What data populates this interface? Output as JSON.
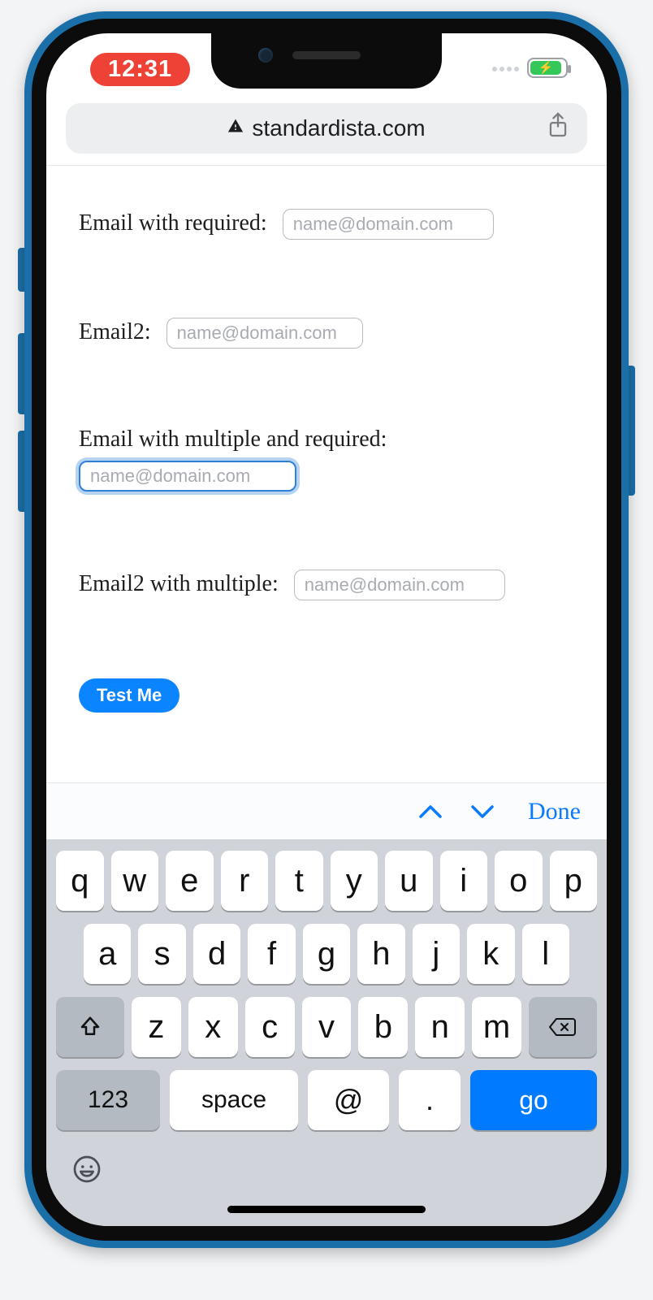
{
  "status": {
    "time": "12:31"
  },
  "url": {
    "domain": "standardista.com"
  },
  "form": {
    "fields": [
      {
        "label": "Email with required:",
        "placeholder": "name@domain.com",
        "value": ""
      },
      {
        "label": "Email2:",
        "placeholder": "name@domain.com",
        "value": ""
      },
      {
        "label": "Email with multiple and required:",
        "placeholder": "name@domain.com",
        "value": ""
      },
      {
        "label": "Email2 with multiple:",
        "placeholder": "name@domain.com",
        "value": ""
      }
    ],
    "submit_label": "Test Me"
  },
  "accessory": {
    "done_label": "Done"
  },
  "keyboard": {
    "row1": [
      "q",
      "w",
      "e",
      "r",
      "t",
      "y",
      "u",
      "i",
      "o",
      "p"
    ],
    "row2": [
      "a",
      "s",
      "d",
      "f",
      "g",
      "h",
      "j",
      "k",
      "l"
    ],
    "row3": [
      "z",
      "x",
      "c",
      "v",
      "b",
      "n",
      "m"
    ],
    "numbers_label": "123",
    "space_label": "space",
    "at_label": "@",
    "dot_label": ".",
    "go_label": "go"
  }
}
